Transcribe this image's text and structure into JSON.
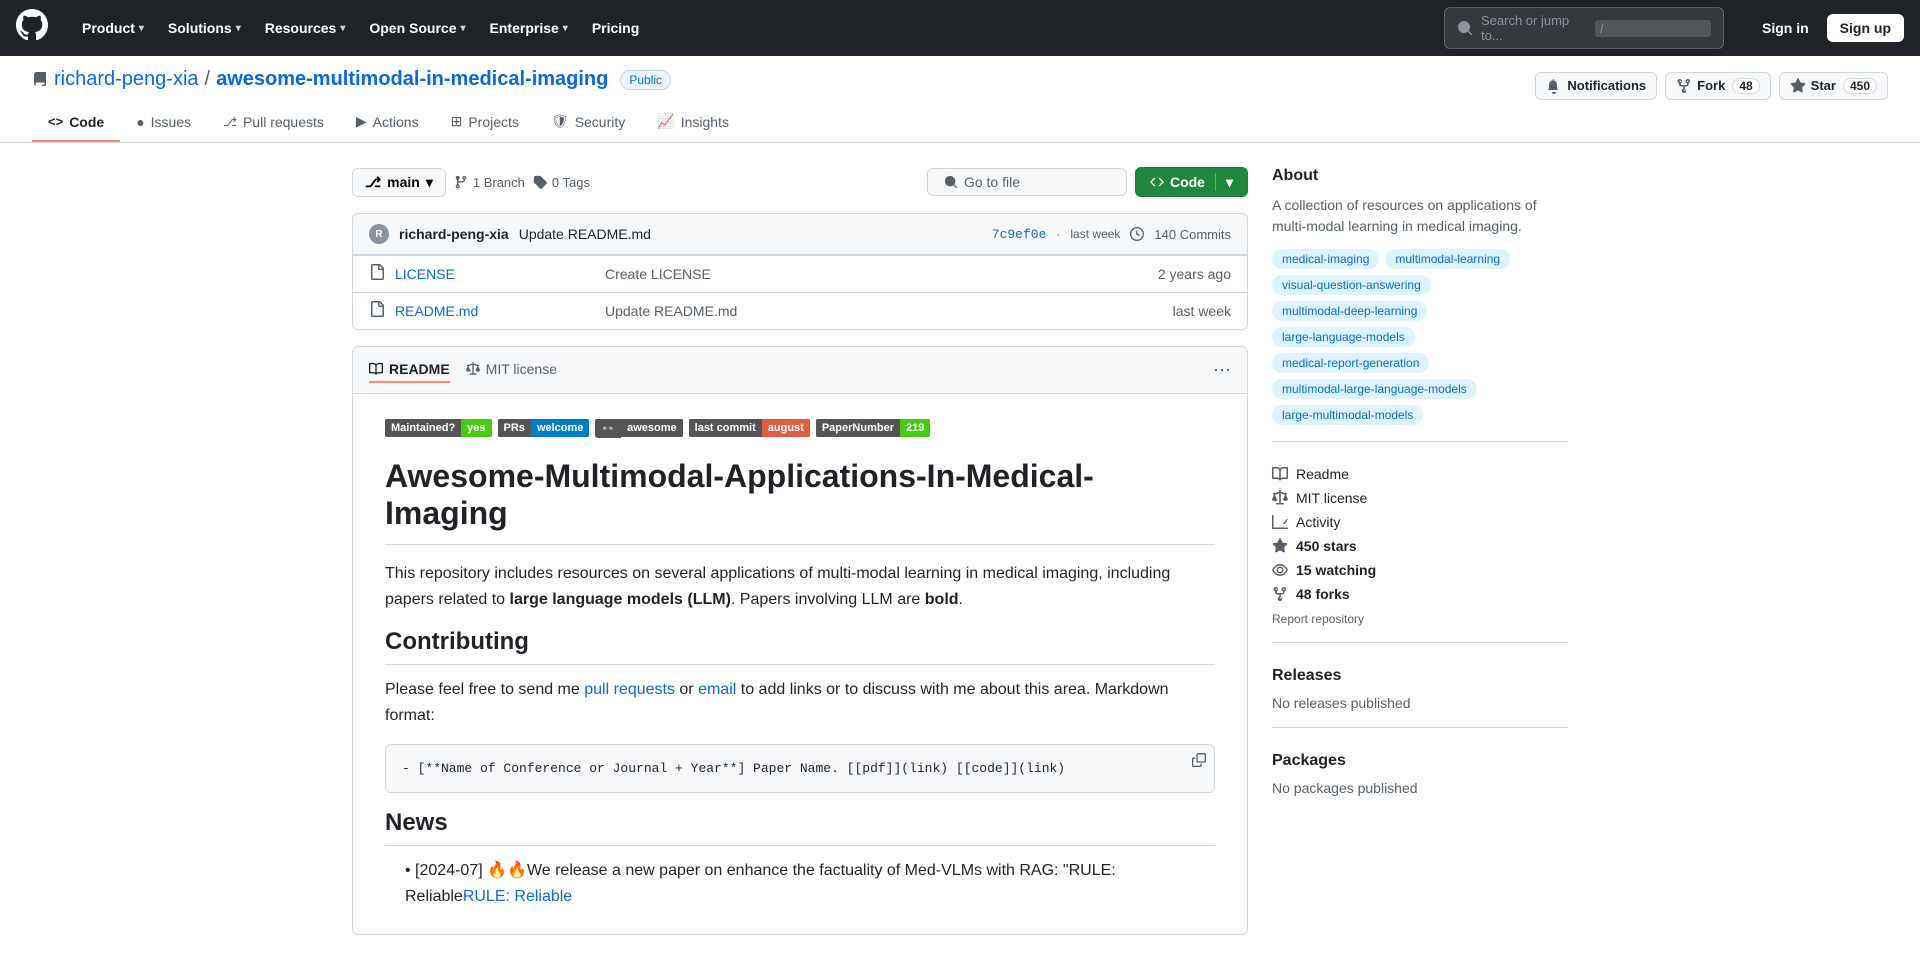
{
  "topnav": {
    "logo": "⬤",
    "links": [
      {
        "label": "Product",
        "id": "product"
      },
      {
        "label": "Solutions",
        "id": "solutions"
      },
      {
        "label": "Resources",
        "id": "resources"
      },
      {
        "label": "Open Source",
        "id": "open-source"
      },
      {
        "label": "Enterprise",
        "id": "enterprise"
      },
      {
        "label": "Pricing",
        "id": "pricing"
      }
    ],
    "search_placeholder": "Search or jump to...",
    "search_slash": "/",
    "signin": "Sign in",
    "signup": "Sign up"
  },
  "repo": {
    "owner": "richard-peng-xia",
    "name": "awesome-multimodal-in-medical-imaging",
    "visibility": "Public",
    "notifications_label": "Notifications",
    "fork_label": "Fork",
    "fork_count": "48",
    "star_label": "Star",
    "star_count": "450",
    "tabs": [
      {
        "label": "Code",
        "icon": "<>",
        "active": true
      },
      {
        "label": "Issues",
        "icon": "●"
      },
      {
        "label": "Pull requests",
        "icon": "⎇"
      },
      {
        "label": "Actions",
        "icon": "▶"
      },
      {
        "label": "Projects",
        "icon": "⊞"
      },
      {
        "label": "Security",
        "icon": "🛡"
      },
      {
        "label": "Insights",
        "icon": "📈"
      }
    ]
  },
  "filecontrols": {
    "branch": "main",
    "branches_label": "1 Branch",
    "tags_label": "0 Tags",
    "go_to_file": "Go to file",
    "code_btn": "Code"
  },
  "commit_bar": {
    "avatar_url": "",
    "author": "richard-peng-xia",
    "message": "Update README.md",
    "hash": "7c9ef0e",
    "time": "last week",
    "commits_count": "140 Commits"
  },
  "files": [
    {
      "icon": "📄",
      "name": "LICENSE",
      "message": "Create LICENSE",
      "time": "2 years ago"
    },
    {
      "icon": "📄",
      "name": "README.md",
      "message": "Update README.md",
      "time": "last week"
    }
  ],
  "readme": {
    "tab_readme": "README",
    "tab_license": "MIT license",
    "badges": [
      {
        "left": "Maintained?",
        "right": "yes",
        "left_color": "#555",
        "right_color": "#4c1"
      },
      {
        "left": "PRs",
        "right": "welcome",
        "left_color": "#555",
        "right_color": "#007ec6"
      },
      {
        "left": "👓",
        "right": "awesome",
        "left_color": "#555",
        "right_color": "#555"
      },
      {
        "left": "last commit",
        "right": "august",
        "left_color": "#555",
        "right_color": "#e05d44"
      },
      {
        "left": "PaperNumber",
        "right": "219",
        "left_color": "#555",
        "right_color": "#4c1"
      }
    ],
    "title": "Awesome-Multimodal-Applications-In-Medical-Imaging",
    "intro": "This repository includes resources on several applications of multi-modal learning in medical imaging, including papers related to large language models (LLM). Papers involving LLM are bold.",
    "contributing_title": "Contributing",
    "contributing_text": "Please feel free to send me pull requests or email to add links or to discuss with me about this area. Markdown format:",
    "code_block": "- [**Name of Conference or Journal + Year**] Paper Name. [[pdf]](link) [[code]](link)",
    "news_title": "News",
    "news_item": "[2024-07] 🔥🔥We release a new paper on enhance the factuality of Med-VLMs with RAG: \"RULE: Reliable"
  },
  "sidebar": {
    "about_title": "About",
    "description": "A collection of resources on applications of multi-modal learning in medical imaging.",
    "topics": [
      "medical-imaging",
      "multimodal-learning",
      "visual-question-answering",
      "multimodal-deep-learning",
      "large-language-models",
      "medical-report-generation",
      "multimodal-large-language-models",
      "large-multimodal-models"
    ],
    "readme_label": "Readme",
    "license_label": "MIT license",
    "activity_label": "Activity",
    "stars_label": "450 stars",
    "watching_label": "15 watching",
    "forks_label": "48 forks",
    "report_label": "Report repository",
    "releases_title": "Releases",
    "no_releases": "No releases published",
    "packages_title": "Packages",
    "no_packages": "No packages published"
  }
}
